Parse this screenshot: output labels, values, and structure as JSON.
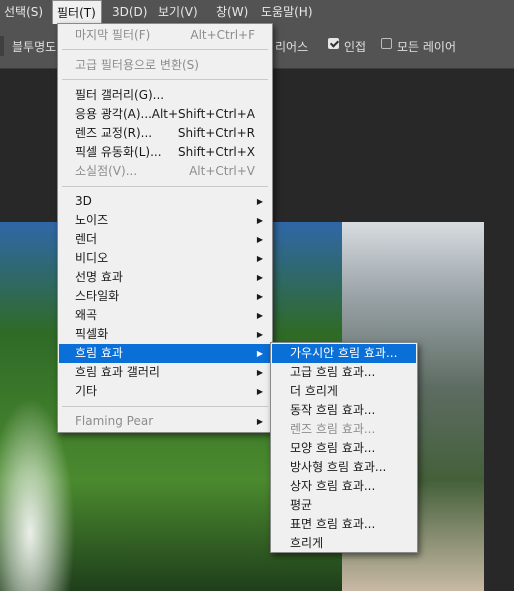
{
  "menubar": {
    "items": [
      "선택(S)",
      "필터(T)",
      "3D(D)",
      "보기(V)",
      "창(W)",
      "도움말(H)"
    ],
    "active": "필터(T)"
  },
  "options_bar": {
    "left_text": "블투명도",
    "partial_text": "리어스",
    "adjacent_label": "인접",
    "adjacent_checked": true,
    "all_layers_label": "모든 레이어",
    "all_layers_checked": false
  },
  "filter_menu": {
    "last_filter": "마지막 필터(F)",
    "last_filter_shortcut": "Alt+Ctrl+F",
    "convert_smart": "고급 필터용으로 변환(S)",
    "filter_gallery": "필터 갤러리(G)...",
    "adaptive_wide_angle": "응용 광각(A)...",
    "adaptive_wide_angle_shortcut": "Alt+Shift+Ctrl+A",
    "lens_correction": "렌즈 교정(R)...",
    "lens_correction_shortcut": "Shift+Ctrl+R",
    "liquify": "픽셀 유동화(L)...",
    "liquify_shortcut": "Shift+Ctrl+X",
    "vanishing_point": "소실점(V)...",
    "vanishing_point_shortcut": "Alt+Ctrl+V",
    "submenus": [
      "3D",
      "노이즈",
      "렌더",
      "비디오",
      "선명 효과",
      "스타일화",
      "왜곡",
      "픽셀화",
      "흐림 효과",
      "흐림 효과 갤러리",
      "기타"
    ],
    "highlighted": "흐림 효과",
    "plugin": "Flaming Pear"
  },
  "blur_submenu": {
    "items": [
      "가우시안 흐림 효과...",
      "고급 흐림 효과...",
      "더 흐리게",
      "동작 흐림 효과...",
      "렌즈 흐림 효과...",
      "모양 흐림 효과...",
      "방사형 흐림 효과...",
      "상자 흐림 효과...",
      "평균",
      "표면 흐림 효과...",
      "흐리게"
    ],
    "disabled": [
      "렌즈 흐림 효과..."
    ],
    "highlighted": "가우시안 흐림 효과..."
  },
  "colors": {
    "highlight": "#0a6fd7",
    "menu_bg": "#f0f0f0",
    "chrome_bg": "#535353"
  }
}
